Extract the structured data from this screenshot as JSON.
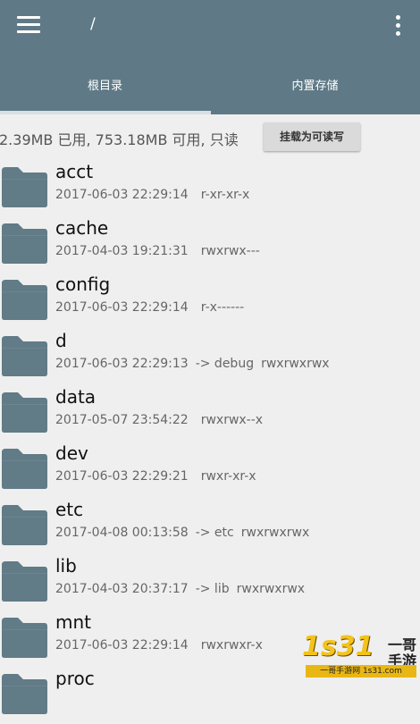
{
  "header": {
    "path": "/"
  },
  "tabs": [
    {
      "label": "根目录",
      "active": true
    },
    {
      "label": "内置存储",
      "active": false
    }
  ],
  "storage": {
    "info": "2.39MB 已用, 753.18MB 可用, 只读",
    "mount_button": "挂载为可读写"
  },
  "folder_icon_color": "#617b87",
  "entries": [
    {
      "name": "acct",
      "time": "2017-06-03 22:29:14",
      "link": "",
      "perm": "r-xr-xr-x"
    },
    {
      "name": "cache",
      "time": "2017-04-03 19:21:31",
      "link": "",
      "perm": "rwxrwx---"
    },
    {
      "name": "config",
      "time": "2017-06-03 22:29:14",
      "link": "",
      "perm": "r-x------"
    },
    {
      "name": "d",
      "time": "2017-06-03 22:29:13",
      "link": "-> debug",
      "perm": "rwxrwxrwx"
    },
    {
      "name": "data",
      "time": "2017-05-07 23:54:22",
      "link": "",
      "perm": "rwxrwx--x"
    },
    {
      "name": "dev",
      "time": "2017-06-03 22:29:21",
      "link": "",
      "perm": "rwxr-xr-x"
    },
    {
      "name": "etc",
      "time": "2017-04-08 00:13:58",
      "link": "-> etc",
      "perm": "rwxrwxrwx"
    },
    {
      "name": "lib",
      "time": "2017-04-03 20:37:17",
      "link": "-> lib",
      "perm": "rwxrwxrwx"
    },
    {
      "name": "mnt",
      "time": "2017-06-03 22:29:14",
      "link": "",
      "perm": "rwxrwxr-x"
    },
    {
      "name": "proc",
      "time": "",
      "link": "",
      "perm": ""
    }
  ],
  "watermark": {
    "number": "1s31",
    "line1": "一哥",
    "line2": "手游",
    "strip": "一哥手游网 1s31.com"
  }
}
